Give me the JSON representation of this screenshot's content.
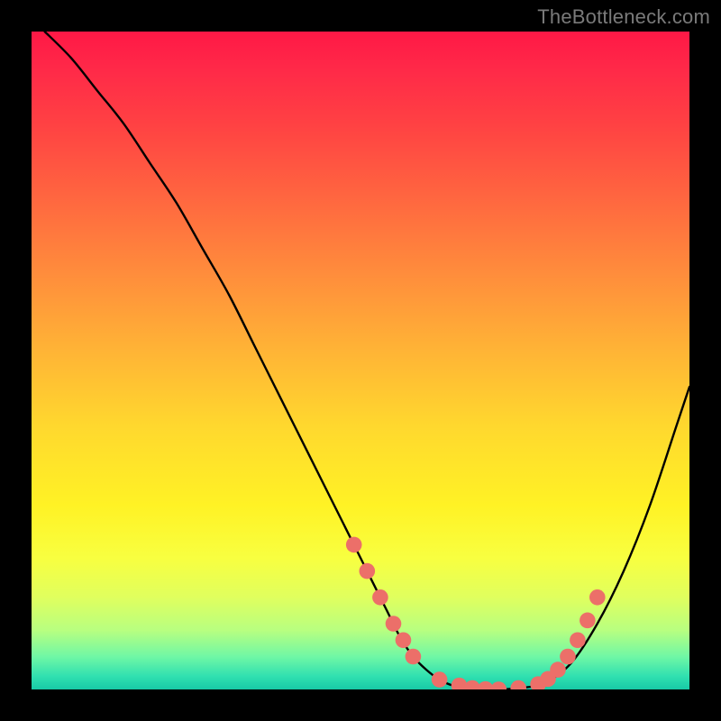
{
  "watermark": {
    "text": "TheBottleneck.com"
  },
  "colors": {
    "background": "#000000",
    "curve_stroke": "#000000",
    "marker_fill": "#ec6f69",
    "marker_stroke": "#cf5a55",
    "gradient_top": "#ff1846",
    "gradient_bottom": "#18c9a6"
  },
  "chart_data": {
    "type": "line",
    "title": "",
    "xlabel": "",
    "ylabel": "",
    "xlim": [
      0,
      100
    ],
    "ylim": [
      0,
      100
    ],
    "grid": false,
    "legend": false,
    "annotations": [],
    "series": [
      {
        "name": "bottleneck-curve",
        "x": [
          2,
          6,
          10,
          14,
          18,
          22,
          26,
          30,
          34,
          38,
          42,
          46,
          50,
          52,
          54,
          56,
          58,
          60,
          62,
          64,
          66,
          70,
          74,
          78,
          82,
          86,
          90,
          94,
          98,
          100
        ],
        "y": [
          100,
          96,
          91,
          86,
          80,
          74,
          67,
          60,
          52,
          44,
          36,
          28,
          20,
          16,
          12,
          8,
          5,
          3,
          1.5,
          0.6,
          0.2,
          0,
          0.2,
          1,
          4,
          10,
          18,
          28,
          40,
          46
        ]
      }
    ],
    "markers": {
      "name": "highlight-dots",
      "x": [
        49,
        51,
        53,
        55,
        56.5,
        58,
        62,
        65,
        67,
        69,
        71,
        74,
        77,
        78.5,
        80,
        81.5,
        83,
        84.5,
        86
      ],
      "y": [
        22,
        18,
        14,
        10,
        7.5,
        5,
        1.5,
        0.6,
        0.2,
        0.05,
        0,
        0.2,
        0.8,
        1.6,
        3,
        5,
        7.5,
        10.5,
        14
      ]
    }
  }
}
